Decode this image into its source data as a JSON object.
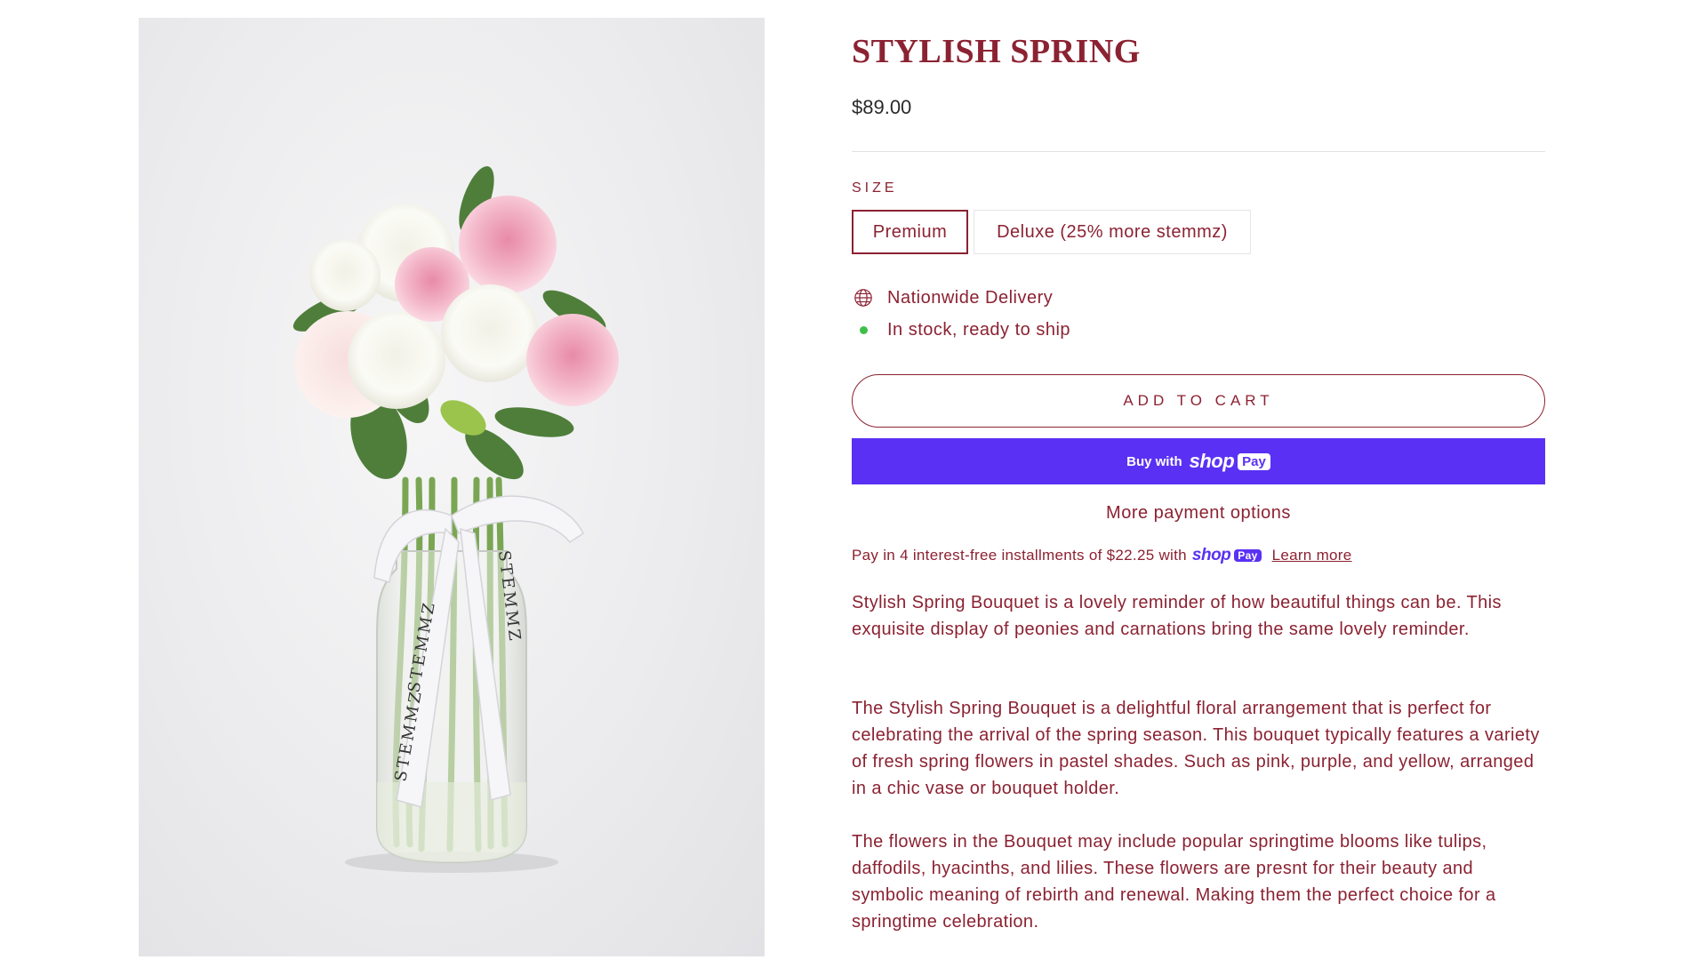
{
  "product": {
    "title": "STYLISH SPRING",
    "price": "$89.00",
    "image_alt": "Bouquet of pink peonies and white carnations in a glass vase tied with STEMMZ ribbon",
    "ribbon_text": "STEMMZ"
  },
  "size": {
    "label": "SIZE",
    "options": [
      "Premium",
      "Deluxe (25% more stemmz)"
    ],
    "selected": "Premium"
  },
  "info": {
    "delivery": "Nationwide Delivery",
    "stock": "In stock, ready to ship"
  },
  "buttons": {
    "add_to_cart": "ADD TO CART",
    "buy_with": "Buy with",
    "shop_word": "shop",
    "pay_word": "Pay",
    "more_payment": "More payment options"
  },
  "installments": {
    "text": "Pay in 4 interest-free installments of $22.25 with",
    "learn_more": "Learn more"
  },
  "description": [
    "Stylish Spring Bouquet is a lovely reminder of how beautiful things can be. This exquisite display of peonies and carnations bring the same lovely reminder.",
    "The Stylish Spring Bouquet is a delightful floral arrangement that is perfect for celebrating the arrival of the spring season. This bouquet typically features a variety of fresh spring flowers in pastel shades. Such as pink, purple, and yellow, arranged in a chic vase or bouquet holder.",
    "The flowers in the Bouquet may include popular springtime blooms like tulips, daffodils, hyacinths, and lilies. These flowers are presnt for their beauty and symbolic meaning of rebirth and renewal. Making them the perfect choice for a springtime celebration."
  ],
  "colors": {
    "brand": "#8b2232",
    "shop_pay": "#5a31f4",
    "in_stock": "#3fbf4a"
  },
  "icons": {
    "delivery": "globe-icon",
    "stock": "green-dot-icon"
  }
}
